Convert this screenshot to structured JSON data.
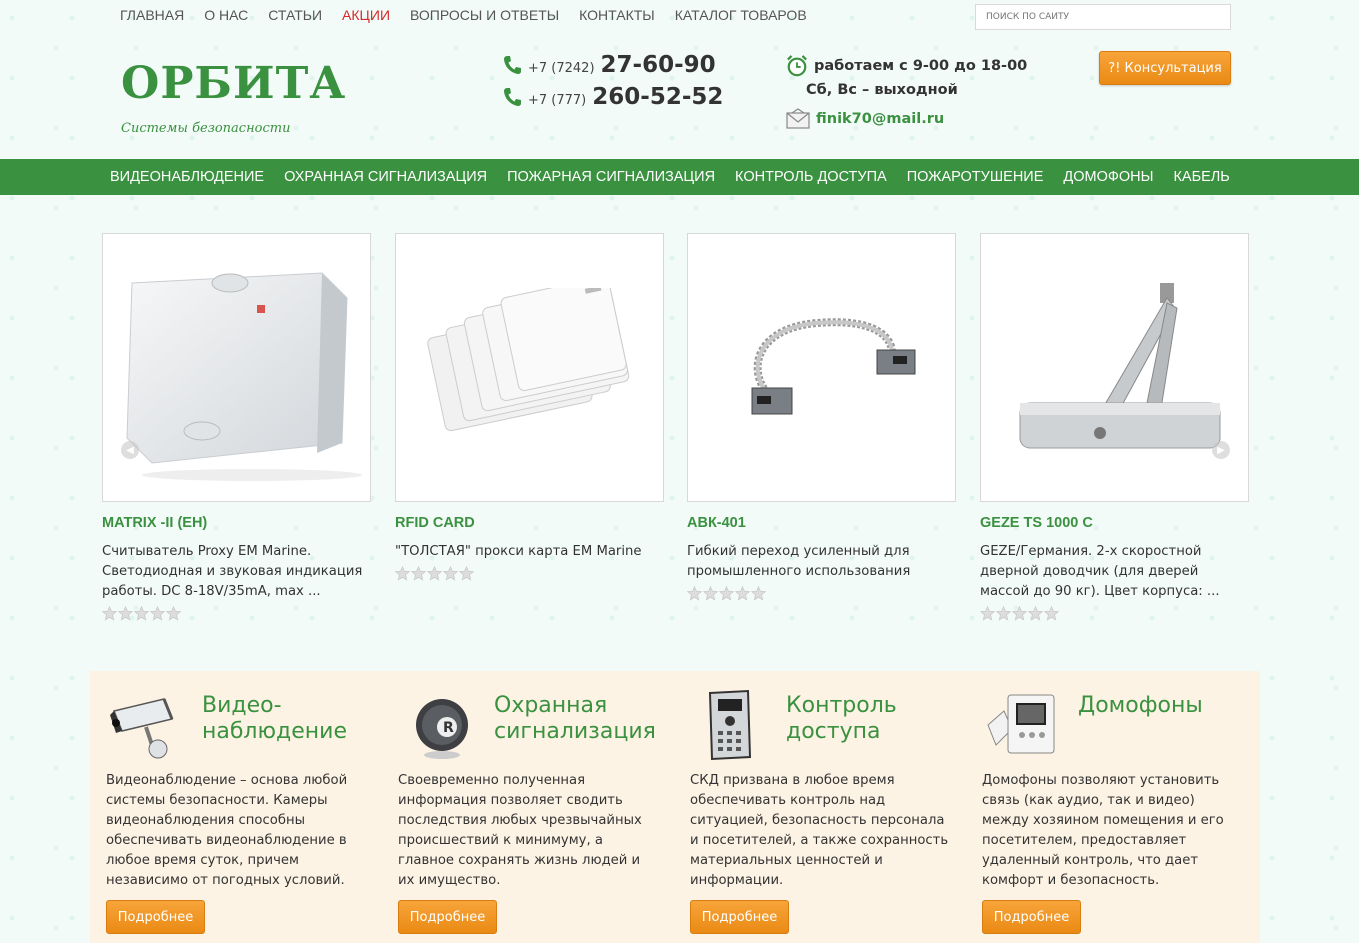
{
  "topnav": {
    "items": [
      "ГЛАВНАЯ",
      "О НАС",
      "СТАТЬИ",
      "АКЦИИ",
      "ВОПРОСЫ И ОТВЕТЫ",
      "КОНТАКТЫ",
      "КАТАЛОГ ТОВАРОВ"
    ],
    "active_color": "#d62b2b"
  },
  "search": {
    "placeholder": "ПОИСК ПО САЙТУ"
  },
  "header": {
    "logo": "ОРБИТА",
    "tagline": "Системы безопасности",
    "phone1_code": "+7 (7242)",
    "phone1_num": "27-60-90",
    "phone2_code": "+7 (777)",
    "phone2_num": "260-52-52",
    "hours": "работаем с 9-00 до 18-00",
    "weekend": "Сб, Вс – выходной",
    "email": "finik70@mail.ru",
    "consult_label": "?! Консультация"
  },
  "mainnav": {
    "items": [
      "ВИДЕОНАБЛЮДЕНИЕ",
      "ОХРАННАЯ СИГНАЛИЗАЦИЯ",
      "ПОЖАРНАЯ СИГНАЛИЗАЦИЯ",
      "КОНТРОЛЬ ДОСТУПА",
      "ПОЖАРОТУШЕНИЕ",
      "ДОМОФОНЫ",
      "КАБЕЛЬ"
    ]
  },
  "products": [
    {
      "title": "MATRIX -II (EH)",
      "desc": "Считыватель Proxy EM Marine. Светодиодная и звуковая индикация работы. DC 8-18V/35mA, max ...",
      "rating": 0
    },
    {
      "title": "RFID CARD",
      "desc": "\"ТОЛСТАЯ\" прокси карта EM Marine",
      "rating": 0
    },
    {
      "title": "АВК-401",
      "desc": "Гибкий переход усиленный для промышленного использования",
      "rating": 0
    },
    {
      "title": "GEZE TS 1000 C",
      "desc": "GEZE/Германия. 2-х скоростной дверной доводчик (для дверей массой до 90 кг). Цвет корпуса: ...",
      "rating": 0
    }
  ],
  "services": [
    {
      "title": "Видео-\nнаблюдение",
      "icon": "camera-icon",
      "text": "Видеонаблюдение – основа любой системы безопасности. Камеры видеонаблюдения способны обеспечивать видеонаблюдение в любое время суток, причем независимо от погодных условий.",
      "button": "Подробнее"
    },
    {
      "title": "Охранная\nсигнализация",
      "icon": "alarm-icon",
      "text": "Своевременно полученная информация позволяет сводить последствия любых чрезвычайных происшествий к минимуму, а главное сохранять жизнь людей и их имущество.",
      "button": "Подробнее"
    },
    {
      "title": "Контроль\nдоступа",
      "icon": "access-panel-icon",
      "text": "СКД призвана в любое время обеспечивать контроль над ситуацией, безопасность персонала и посетителей, а также сохранность материальных ценностей и информации.",
      "button": "Подробнее"
    },
    {
      "title": "Домофоны",
      "icon": "intercom-icon",
      "text": "Домофоны позволяют установить связь (как аудио, так и видео) между хозяином помещения и его посетителем, предоставляет удаленный контроль, что дает комфорт и безопасность.",
      "button": "Подробнее"
    }
  ],
  "colors": {
    "brand_green": "#3a9140",
    "accent_orange": "#f39a2a",
    "services_bg": "#fdf3e4"
  }
}
